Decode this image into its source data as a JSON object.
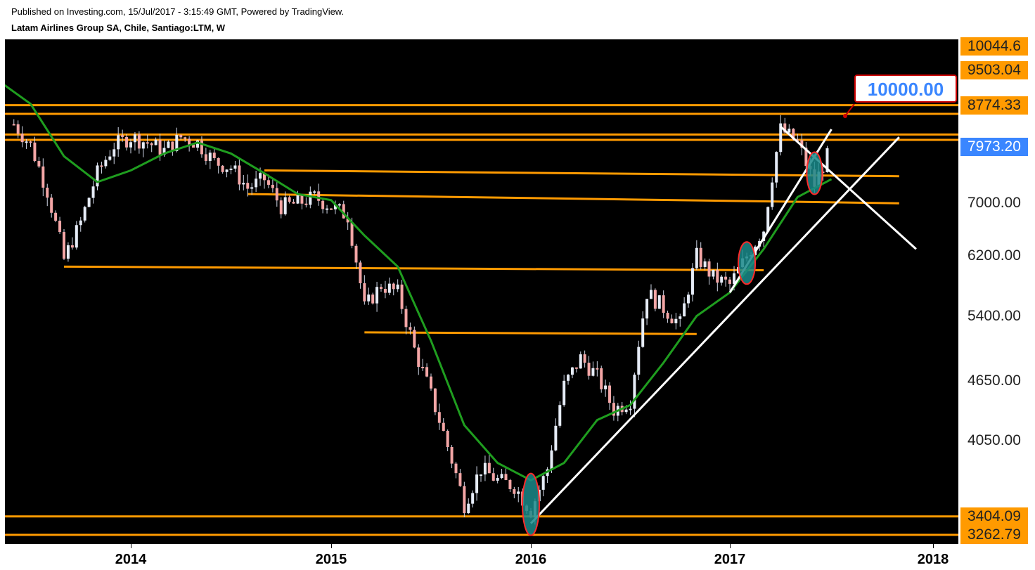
{
  "header": {
    "published": "Published on Investing.com, 15/Jul/2017 - 3:15:49 GMT, Powered by TradingView.",
    "symbol": "Latam Airlines Group SA, Chile, Santiago:LTM, W"
  },
  "callout": {
    "text": "10000.00"
  },
  "price_labels": [
    {
      "text": "10044.6",
      "value": 10044.6,
      "style": "orange"
    },
    {
      "text": "9503.04",
      "value": 9503.04,
      "style": "orange"
    },
    {
      "text": "8774.33",
      "value": 8774.33,
      "style": "orange"
    },
    {
      "text": "7973.20",
      "value": 7973.2,
      "style": "current"
    },
    {
      "text": "7000.00",
      "value": 7000.0,
      "style": "plain"
    },
    {
      "text": "6200.00",
      "value": 6200.0,
      "style": "plain"
    },
    {
      "text": "5400.00",
      "value": 5400.0,
      "style": "plain"
    },
    {
      "text": "4650.00",
      "value": 4650.0,
      "style": "plain"
    },
    {
      "text": "4050.00",
      "value": 4050.0,
      "style": "plain"
    },
    {
      "text": "3404.09",
      "value": 3404.09,
      "style": "orange"
    },
    {
      "text": "3262.79",
      "value": 3262.79,
      "style": "orange"
    }
  ],
  "x_labels": [
    "2014",
    "2015",
    "2016",
    "2017",
    "2018"
  ],
  "colors": {
    "background": "#000000",
    "up_candle": "#e6ecf7",
    "down_candle": "#f4a6a6",
    "moving_average": "#1f9d1f",
    "support_resistance": "#ff9a00",
    "trendline": "#ffffff",
    "highlight_fill": "#1a8a8a",
    "highlight_border": "#ff2a2a",
    "current_price": "#3a86ff"
  },
  "chart_data": {
    "type": "candlestick",
    "interval": "W",
    "x_range": [
      "2013-05",
      "2018-02"
    ],
    "y_scale": "log",
    "close_series": [
      [
        "2013-06",
        8400
      ],
      [
        "2013-07",
        8000
      ],
      [
        "2013-08",
        7200
      ],
      [
        "2013-09",
        6150
      ],
      [
        "2013-10",
        6700
      ],
      [
        "2013-11",
        7500
      ],
      [
        "2013-12",
        8000
      ],
      [
        "2014-01",
        8150
      ],
      [
        "2014-02",
        8050
      ],
      [
        "2014-03",
        7900
      ],
      [
        "2014-04",
        8150
      ],
      [
        "2014-05",
        8050
      ],
      [
        "2014-06",
        7700
      ],
      [
        "2014-07",
        7600
      ],
      [
        "2014-08",
        7250
      ],
      [
        "2014-09",
        7400
      ],
      [
        "2014-10",
        6950
      ],
      [
        "2014-11",
        7000
      ],
      [
        "2014-12",
        7100
      ],
      [
        "2015-01",
        6950
      ],
      [
        "2015-02",
        6800
      ],
      [
        "2015-03",
        5500
      ],
      [
        "2015-04",
        5800
      ],
      [
        "2015-05",
        5700
      ],
      [
        "2015-06",
        5000
      ],
      [
        "2015-07",
        4500
      ],
      [
        "2015-08",
        4000
      ],
      [
        "2015-09",
        3500
      ],
      [
        "2015-10",
        3800
      ],
      [
        "2015-11",
        3700
      ],
      [
        "2015-12",
        3650
      ],
      [
        "2016-01",
        3450
      ],
      [
        "2016-02",
        3800
      ],
      [
        "2016-03",
        4600
      ],
      [
        "2016-04",
        4900
      ],
      [
        "2016-05",
        4700
      ],
      [
        "2016-06",
        4350
      ],
      [
        "2016-07",
        4450
      ],
      [
        "2016-08",
        5700
      ],
      [
        "2016-09",
        5500
      ],
      [
        "2016-10",
        5300
      ],
      [
        "2016-11",
        6200
      ],
      [
        "2016-12",
        5900
      ],
      [
        "2017-01",
        5800
      ],
      [
        "2017-02",
        6200
      ],
      [
        "2017-03",
        6600
      ],
      [
        "2017-04",
        8300
      ],
      [
        "2017-05",
        8050
      ],
      [
        "2017-06",
        7300
      ],
      [
        "2017-07",
        7973.2
      ]
    ],
    "moving_average": [
      [
        "2013-05",
        9300
      ],
      [
        "2013-07",
        8800
      ],
      [
        "2013-09",
        7800
      ],
      [
        "2013-11",
        7350
      ],
      [
        "2014-01",
        7550
      ],
      [
        "2014-03",
        7850
      ],
      [
        "2014-05",
        8050
      ],
      [
        "2014-07",
        7850
      ],
      [
        "2014-09",
        7500
      ],
      [
        "2014-11",
        7150
      ],
      [
        "2015-01",
        7050
      ],
      [
        "2015-03",
        6500
      ],
      [
        "2015-05",
        6050
      ],
      [
        "2015-07",
        5100
      ],
      [
        "2015-09",
        4200
      ],
      [
        "2015-11",
        3850
      ],
      [
        "2016-01",
        3700
      ],
      [
        "2016-03",
        3850
      ],
      [
        "2016-05",
        4250
      ],
      [
        "2016-07",
        4400
      ],
      [
        "2016-09",
        4850
      ],
      [
        "2016-11",
        5400
      ],
      [
        "2017-01",
        5700
      ],
      [
        "2017-03",
        6300
      ],
      [
        "2017-05",
        7100
      ],
      [
        "2017-07",
        7400
      ]
    ],
    "horizontal_levels": [
      8774.33,
      8600,
      8200,
      8100,
      3404.09,
      3262.79
    ],
    "target": 10000.0,
    "current": 7973.2
  }
}
